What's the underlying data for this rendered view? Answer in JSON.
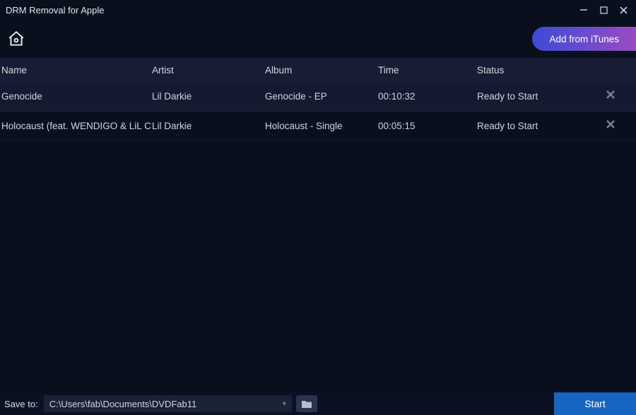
{
  "titlebar": {
    "title": "DRM Removal for Apple"
  },
  "toolbar": {
    "add_label": "Add from iTunes"
  },
  "table": {
    "headers": {
      "name": "Name",
      "artist": "Artist",
      "album": "Album",
      "time": "Time",
      "status": "Status"
    },
    "rows": [
      {
        "name": "Genocide",
        "artist": "Lil Darkie",
        "album": "Genocide - EP",
        "time": "00:10:32",
        "status": "Ready to Start"
      },
      {
        "name": "Holocaust (feat. WENDIGO & LiL CU",
        "artist": "Lil Darkie",
        "album": "Holocaust - Single",
        "time": "00:05:15",
        "status": "Ready to Start"
      }
    ]
  },
  "footer": {
    "save_label": "Save to:",
    "path": "C:\\Users\\fab\\Documents\\DVDFab11",
    "start_label": "Start"
  }
}
